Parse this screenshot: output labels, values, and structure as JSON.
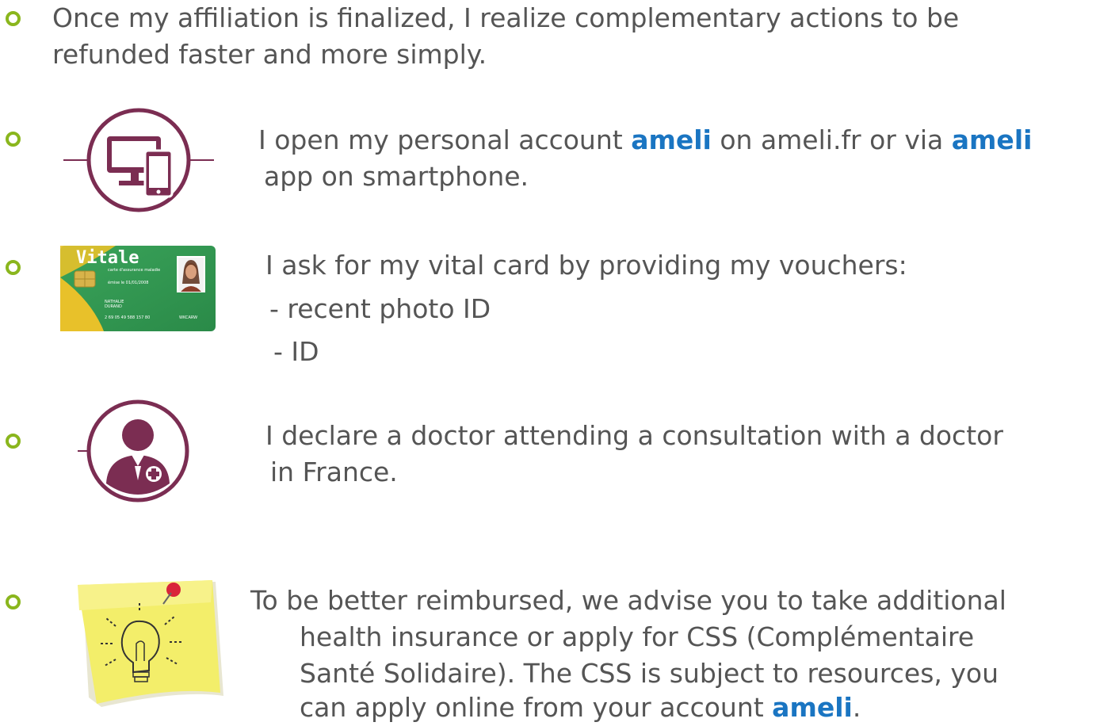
{
  "colors": {
    "bullet": "#8ab61d",
    "text": "#555555",
    "brand": "#1a75c2",
    "icon": "#7b2d52"
  },
  "intro": {
    "line1": "Once my affiliation is finalized, I realize complementary actions to be",
    "line2": "refunded faster and more simply."
  },
  "items": [
    {
      "icon": "devices-icon",
      "l1_pre": "I open my personal account ",
      "l1_brand": "ameli",
      "l1_mid": " on ameli.fr or via ",
      "l1_brand2": "ameli",
      "line2": "app on smartphone."
    },
    {
      "icon": "vitale-card-image",
      "card": {
        "brand": "Vitale",
        "subtitle": "carte d'assurance maladie",
        "date": "émise le 01/01/2008",
        "holder1": "NATHALIE",
        "holder2": "DURAND",
        "number": "2 69 05 49 588 157 80",
        "code": "WKCARW"
      },
      "line1": "I ask for my vital card by providing my vouchers:",
      "line2": "- recent  photo ID",
      "line3": "- ID"
    },
    {
      "icon": "doctor-icon",
      "line1": "I declare a doctor attending a consultation with a doctor",
      "line2": "in France."
    },
    {
      "icon": "sticky-note-lightbulb-icon",
      "line1": "To be better reimbursed, we advise you to take additional",
      "line2": "health insurance or apply for CSS (Complémentaire",
      "line3": "Santé Solidaire). The CSS is subject to resources, you",
      "line4_pre": "can apply online from your account ",
      "line4_brand": "ameli",
      "line4_post": "."
    }
  ]
}
